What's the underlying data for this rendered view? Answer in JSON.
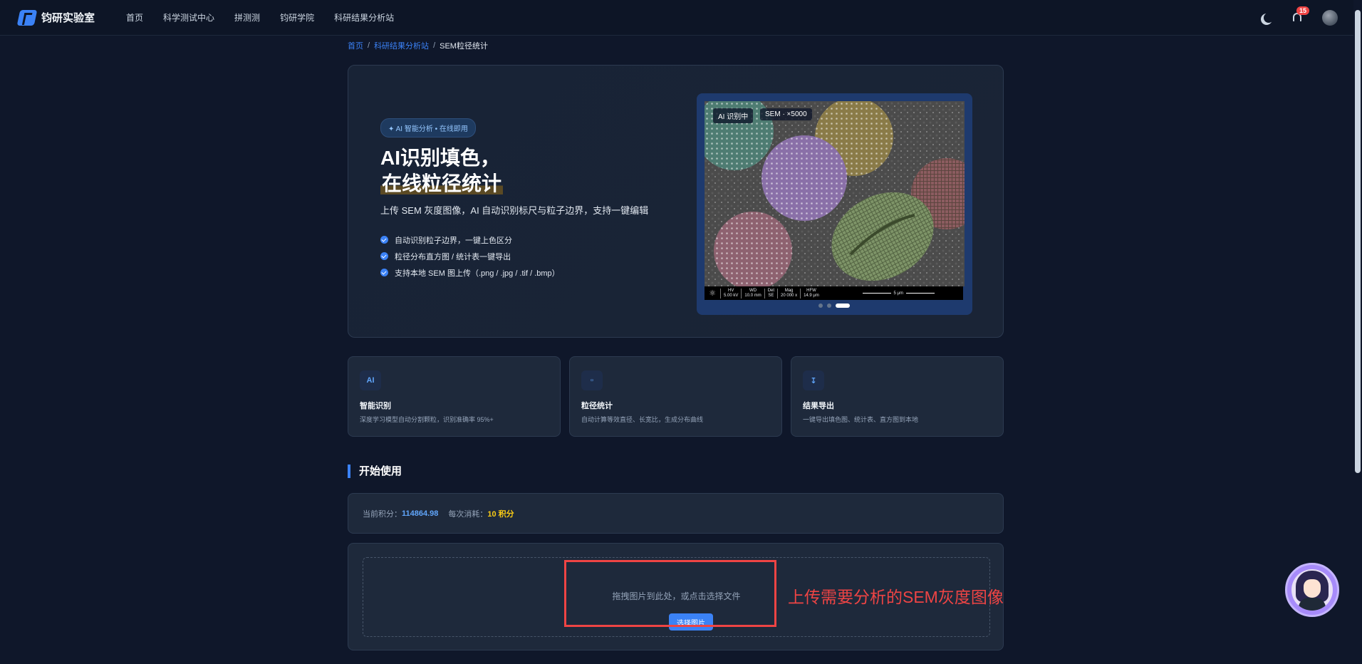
{
  "header": {
    "logo_text": "钧研实验室",
    "nav": [
      "首页",
      "科学测试中心",
      "拼测测",
      "钧研学院",
      "科研结果分析站"
    ],
    "notification_count": "15"
  },
  "breadcrumb": {
    "home": "首页",
    "parent": "科研结果分析站",
    "current": "SEM粒径统计",
    "separator": "/"
  },
  "hero": {
    "pill": "✦ AI 智能分析 • 在线即用",
    "title_line1": "AI识别填色，",
    "title_line2": "在线粒径统计",
    "subtitle": "上传 SEM 灰度图像，AI 自动识别标尺与粒子边界，支持一键编辑",
    "features": [
      "自动识别粒子边界，一键上色区分",
      "粒径分布直方图 / 统计表一键导出",
      "支持本地 SEM 图上传（.png / .jpg / .tif / .bmp）"
    ],
    "image": {
      "tag_ai": "AI 识别中",
      "tag_sem": "SEM · ×5000",
      "info": [
        {
          "k": "HV",
          "v": "5.00 kV"
        },
        {
          "k": "WD",
          "v": "10.0 mm"
        },
        {
          "k": "Det",
          "v": "SE"
        },
        {
          "k": "Mag",
          "v": "20 000 x"
        },
        {
          "k": "HFW",
          "v": "14.9 μm"
        }
      ],
      "scale_label": "5 μm",
      "carousel_count": 3,
      "carousel_active": 3
    }
  },
  "feature_cards": [
    {
      "icon": "AI",
      "icon_name": "ai-icon",
      "title": "智能识别",
      "desc": "深度学习模型自动分割颗粒，识别准确率 95%+"
    },
    {
      "icon": "▫",
      "icon_name": "square-icon",
      "title": "粒径统计",
      "desc": "自动计算等效直径、长宽比，生成分布曲线"
    },
    {
      "icon": "↧",
      "icon_name": "download-icon",
      "title": "结果导出",
      "desc": "一键导出填色图、统计表、直方图到本地"
    }
  ],
  "section": {
    "title": "开始使用"
  },
  "points": {
    "label_current": "当前积分：",
    "current_value": "114864.98",
    "label_cost": "每次消耗：",
    "cost_value": "10 积分"
  },
  "upload": {
    "drop_text": "拖拽图片到此处，或点击选择文件",
    "button": "选择图片"
  },
  "annotation": "上传需要分析的SEM灰度图像",
  "colors": {
    "accent": "#3b82f6",
    "background": "#0f172a",
    "card": "#1e293b",
    "highlight": "#ef4444",
    "cost": "#facc15"
  }
}
